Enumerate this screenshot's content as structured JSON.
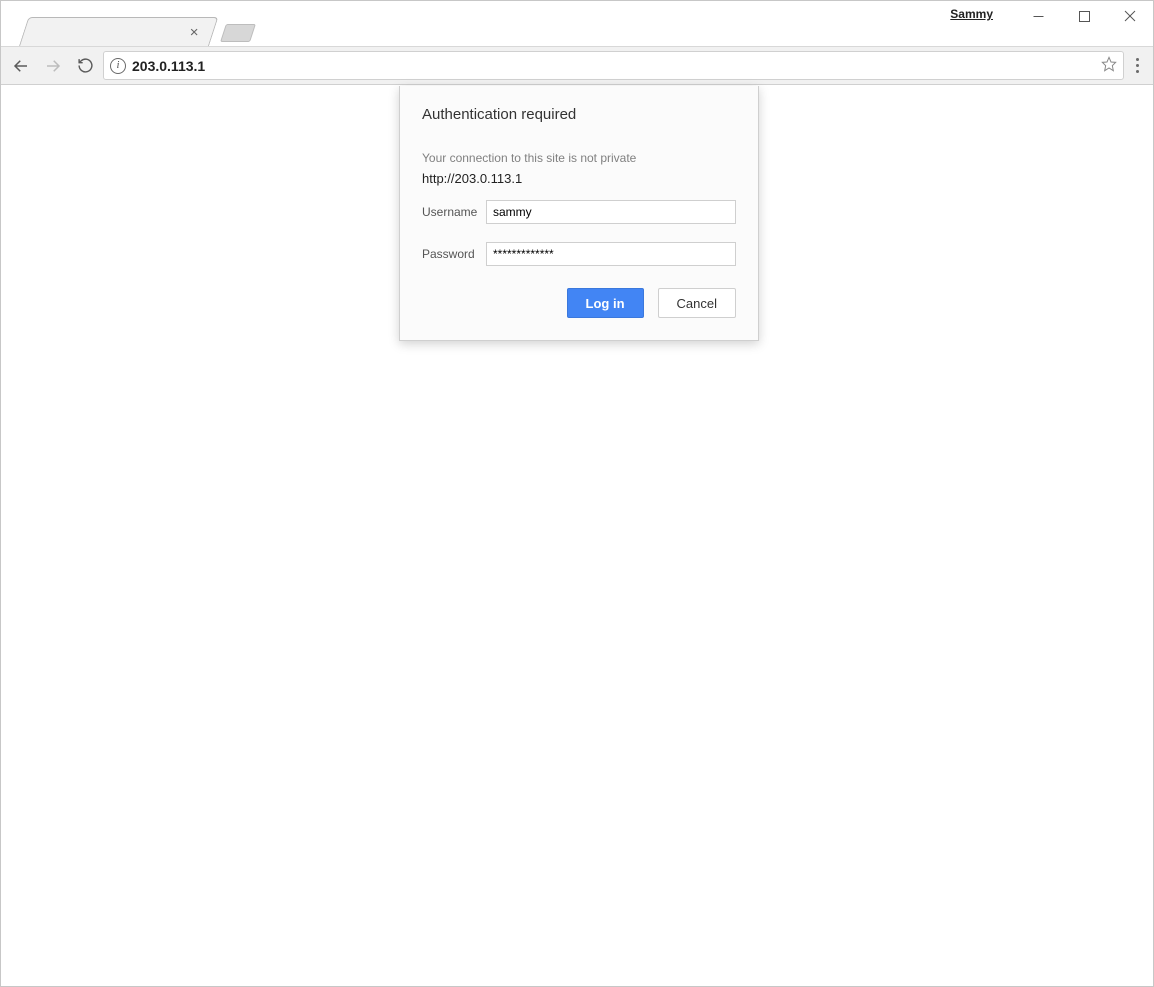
{
  "window": {
    "profile_name": "Sammy"
  },
  "tab": {
    "title": ""
  },
  "toolbar": {
    "address": "203.0.113.1"
  },
  "dialog": {
    "title": "Authentication required",
    "warning": "Your connection to this site is not private",
    "origin": "http://203.0.113.1",
    "username_label": "Username",
    "password_label": "Password",
    "username_value": "sammy",
    "password_value": "*************",
    "login_label": "Log in",
    "cancel_label": "Cancel"
  }
}
